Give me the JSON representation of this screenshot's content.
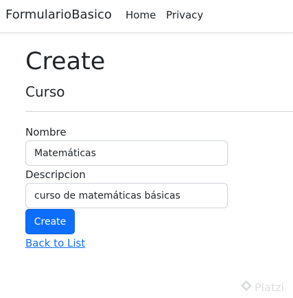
{
  "navbar": {
    "brand": "FormularioBasico",
    "links": [
      "Home",
      "Privacy"
    ]
  },
  "page": {
    "title": "Create",
    "subtitle": "Curso"
  },
  "form": {
    "fields": [
      {
        "label": "Nombre",
        "value": "Matemáticas"
      },
      {
        "label": "Descripcion",
        "value": "curso de matemáticas básicas"
      }
    ],
    "submit_label": "Create"
  },
  "back_link": "Back to List",
  "watermark": {
    "text": "Platzi",
    "icon": "platzi-logo-icon"
  },
  "colors": {
    "primary": "#0d6efd",
    "text": "#212529",
    "border": "#ced4da"
  }
}
